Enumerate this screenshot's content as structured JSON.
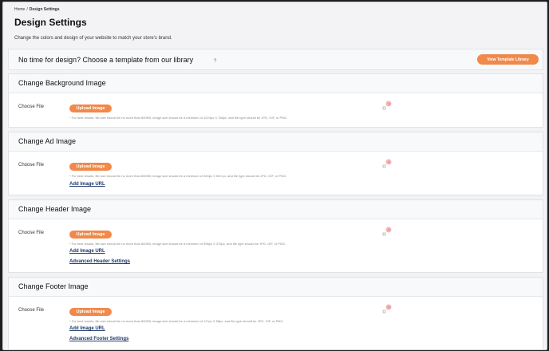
{
  "breadcrumb": {
    "home": "Home",
    "separator": "/",
    "current": "Design Settings"
  },
  "page": {
    "title": "Design Settings",
    "subtitle": "Change the colors and design of your website to match your store's brand."
  },
  "banner": {
    "text": "No time for design? Choose a template from our library",
    "help": "?",
    "button": "View Template Library"
  },
  "sections": [
    {
      "title": "Change Background Image",
      "choose_label": "Choose File",
      "upload_button": "Upload Image",
      "hint": "* For best results, file size should be no more than 800KB, image size should be a minimum of 1024px X 768px, and file type should be JPG, GIF, or PNG."
    },
    {
      "title": "Change Ad Image",
      "choose_label": "Choose File",
      "upload_button": "Upload Image",
      "hint": "* For best results, file size should be no more than 800KB, image size should be a minimum of 300px X 500 px, and file type should be JPG, GIF, or PNG.",
      "link1": "Add Image URL"
    },
    {
      "title": "Change Header Image",
      "choose_label": "Choose File",
      "upload_button": "Upload Image",
      "hint": "* For best results, file size should be no more than 800KB, image size should be a minimum of 998px X 375px, and file type should be JPG, GIF, or PNG.",
      "link1": "Add Image URL",
      "link2": "Advanced Header Settings"
    },
    {
      "title": "Change Footer Image",
      "choose_label": "Choose File",
      "upload_button": "Upload Image",
      "hint": "* For best results, file size should be no more than 800KB, image size should be a minimum of 117px X 58px, and file type should be JPG, GIF, or PNG.",
      "link1": "Add Image URL",
      "link2": "Advanced Footer Settings"
    }
  ],
  "colors": {
    "accent": "#f0894a",
    "link": "#1f3a6d",
    "broken_image_badge": "#f4b6b6"
  },
  "icons": {
    "image_placeholder": "broken-image-icon",
    "help": "question-icon"
  }
}
